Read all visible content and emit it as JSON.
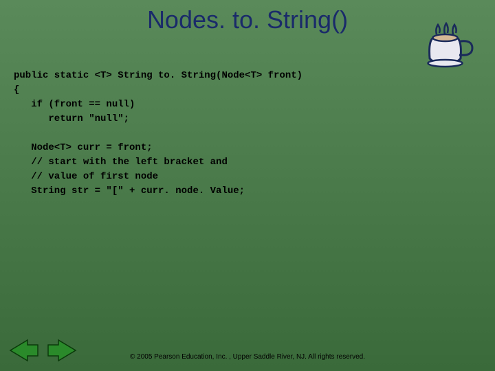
{
  "title": "Nodes. to. String()",
  "code": "public static <T> String to. String(Node<T> front)\n{\n   if (front == null)\n      return \"null\";\n\n   Node<T> curr = front;\n   // start with the left bracket and\n   // value of first node\n   String str = \"[\" + curr. node. Value;",
  "footer": "© 2005 Pearson Education, Inc. , Upper Saddle River, NJ.  All rights reserved.",
  "icons": {
    "coffee": "coffee-cup-icon",
    "prev": "arrow-left-icon",
    "next": "arrow-right-icon"
  }
}
